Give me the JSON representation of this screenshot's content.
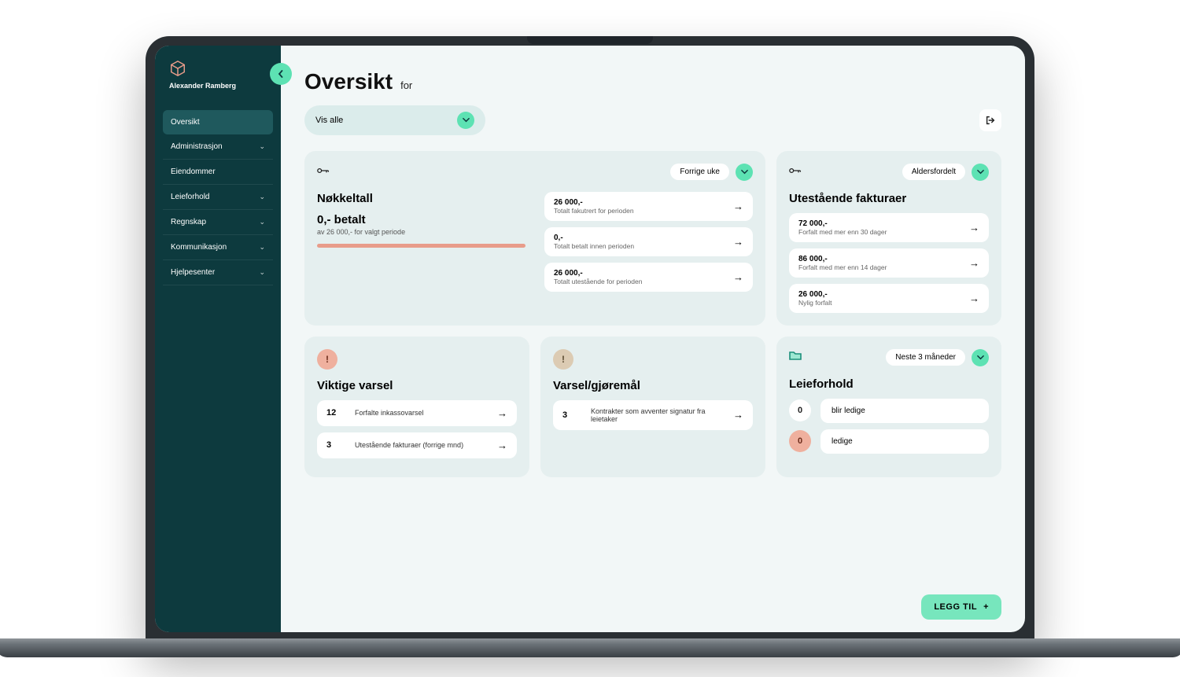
{
  "user": {
    "name": "Alexander Ramberg"
  },
  "sidebar": {
    "items": [
      {
        "label": "Oversikt",
        "active": true,
        "expand": false
      },
      {
        "label": "Administrasjon",
        "active": false,
        "expand": true
      },
      {
        "label": "Eiendommer",
        "active": false,
        "expand": false
      },
      {
        "label": "Leieforhold",
        "active": false,
        "expand": true
      },
      {
        "label": "Regnskap",
        "active": false,
        "expand": true
      },
      {
        "label": "Kommunikasjon",
        "active": false,
        "expand": true
      },
      {
        "label": "Hjelpesenter",
        "active": false,
        "expand": true
      }
    ]
  },
  "header": {
    "title": "Oversikt",
    "for": "for",
    "filter": "Vis alle"
  },
  "nokkeltall": {
    "period_label": "Forrige uke",
    "title": "Nøkkeltall",
    "paid_label": "0,- betalt",
    "sub": "av 26 000,- for valgt periode",
    "rows": [
      {
        "val": "26 000,-",
        "lbl": "Totalt fakutrert for perioden"
      },
      {
        "val": "0,-",
        "lbl": "Totalt betalt innen perioden"
      },
      {
        "val": "26 000,-",
        "lbl": "Totalt utestående for perioden"
      }
    ]
  },
  "utestaaende": {
    "filter": "Aldersfordelt",
    "title": "Utestående fakturaer",
    "rows": [
      {
        "val": "72 000,-",
        "lbl": "Forfalt med mer enn 30 dager"
      },
      {
        "val": "86 000,-",
        "lbl": "Forfalt med mer enn 14 dager"
      },
      {
        "val": "26 000,-",
        "lbl": "Nylig forfalt"
      }
    ]
  },
  "varsel": {
    "title": "Viktige varsel",
    "rows": [
      {
        "n": "12",
        "txt": "Forfalte inkassovarsel"
      },
      {
        "n": "3",
        "txt": "Utestående fakturaer (forrige mnd)"
      }
    ]
  },
  "gjoremaal": {
    "title": "Varsel/gjøremål",
    "rows": [
      {
        "n": "3",
        "txt": "Kontrakter som avventer signatur fra leietaker"
      }
    ]
  },
  "leieforhold": {
    "filter": "Neste 3 måneder",
    "title": "Leieforhold",
    "rows": [
      {
        "n": "0",
        "txt": "blir ledige",
        "variant": "white"
      },
      {
        "n": "0",
        "txt": "ledige",
        "variant": "red"
      }
    ]
  },
  "fab": {
    "label": "LEGG TIL"
  }
}
